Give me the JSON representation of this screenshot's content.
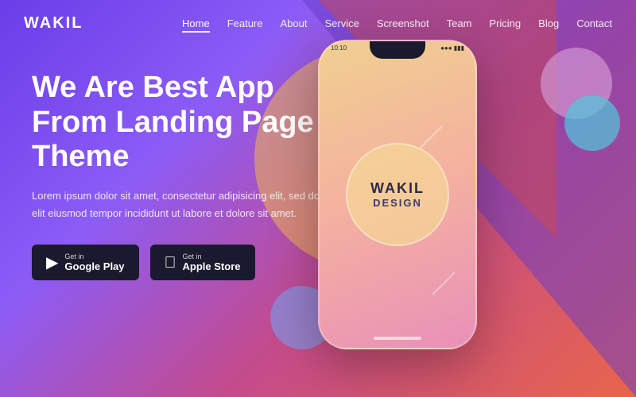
{
  "brand": {
    "logo": "WAKIL"
  },
  "nav": {
    "links": [
      {
        "label": "Home",
        "active": true
      },
      {
        "label": "Feature",
        "active": false
      },
      {
        "label": "About",
        "active": false
      },
      {
        "label": "Service",
        "active": false
      },
      {
        "label": "Screenshot",
        "active": false
      },
      {
        "label": "Team",
        "active": false
      },
      {
        "label": "Pricing",
        "active": false
      },
      {
        "label": "Blog",
        "active": false
      },
      {
        "label": "Contact",
        "active": false
      }
    ]
  },
  "hero": {
    "title": "We Are Best App From Landing Page Theme",
    "description": "Lorem ipsum dolor sit amet, consectetur adipisicing elit, sed do elit eiusmod tempor incididunt ut labore et dolore sit amet.",
    "btn_google_pre": "Get in",
    "btn_google_main": "Google Play",
    "btn_apple_pre": "Get in",
    "btn_apple_main": "Apple Store"
  },
  "phone": {
    "brand": "WAKIL",
    "sub": "DESIGN",
    "time": "10:10"
  }
}
